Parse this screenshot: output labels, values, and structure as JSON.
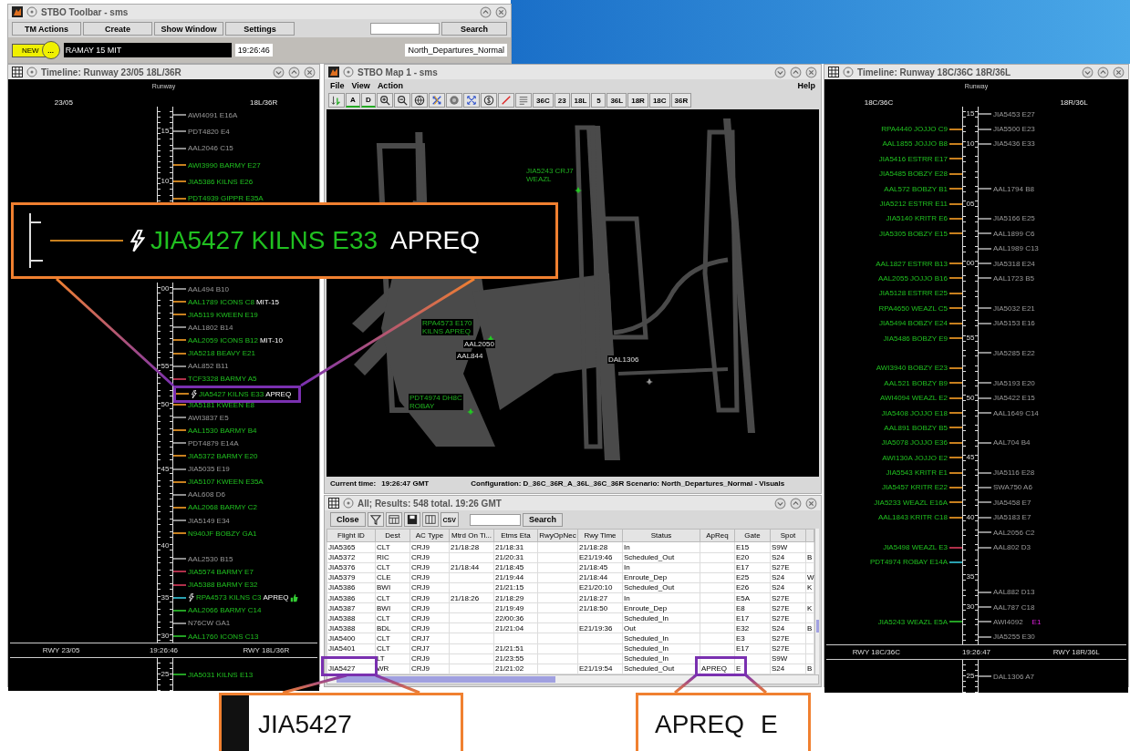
{
  "toolbar_window": {
    "title": "STBO Toolbar - sms",
    "buttons": [
      "TM Actions",
      "Create",
      "Show Window",
      "Settings"
    ],
    "search_button": "Search",
    "new_badge": "NEW",
    "more_button": "...",
    "message": "RAMAY 15 MIT",
    "time": "19:26:46",
    "scenario": "North_Departures_Normal"
  },
  "timelines": [
    {
      "title": "Timeline: Runway 23/05 18L/36R",
      "header": "Runway",
      "left_runway": "23/05",
      "right_runway": "18L/36R",
      "row_groups": [
        {
          "rows": [
            {
              "right": {
                "text": "AWI4091 E16A",
                "assigned": false,
                "color": "#8c8c8c",
                "flagged": false,
                "approved": false
              }
            },
            {
              "tick": "15",
              "right": {
                "text": "PDT4820 E4",
                "assigned": false,
                "color": "#8c8c8c",
                "flagged": false,
                "approved": false
              }
            },
            {
              "right": {
                "text": "AAL2046 C15",
                "assigned": false,
                "color": "#8c8c8c",
                "flagged": false,
                "approved": false
              }
            },
            {
              "right": {
                "text": "AWI3990 BARMY E27",
                "assigned": true,
                "color": "#c8801e",
                "flagged": false,
                "approved": false
              }
            },
            {
              "tick": "10",
              "right": {
                "text": "JIA5386 KILNS E26",
                "assigned": true,
                "color": "#c8801e",
                "flagged": false,
                "approved": false
              }
            },
            {
              "right": {
                "text": "PDT4939 GIPPR E35A",
                "assigned": true,
                "color": "#c8801e",
                "flagged": false,
                "approved": false
              }
            }
          ]
        },
        {
          "rows": [
            {
              "tick": "00",
              "right": {
                "text": "AAL494 B10",
                "assigned": false,
                "color": "#8c8c8c",
                "flagged": false,
                "approved": false
              }
            },
            {
              "right": {
                "text": "AAL1789 ICONS C8",
                "assigned": true,
                "color": "#c8801e",
                "flagged": false,
                "approved": false,
                "note": "MIT-15"
              }
            },
            {
              "right": {
                "text": "JIA5119 KWEEN E19",
                "assigned": true,
                "color": "#c8801e",
                "flagged": false,
                "approved": false
              }
            },
            {
              "right": {
                "text": "AAL1802 B14",
                "assigned": false,
                "color": "#8c8c8c",
                "flagged": false,
                "approved": false
              }
            },
            {
              "right": {
                "text": "AAL2059 ICONS B12",
                "assigned": true,
                "color": "#c8801e",
                "flagged": false,
                "approved": false,
                "note": "MIT-10"
              }
            },
            {
              "right": {
                "text": "JIA5218 BEAVY E21",
                "assigned": true,
                "color": "#c8801e",
                "flagged": false,
                "approved": false
              }
            },
            {
              "tick": "55",
              "right": {
                "text": "AAL852 B11",
                "assigned": false,
                "color": "#8c8c8c",
                "flagged": false,
                "approved": false
              }
            },
            {
              "right": {
                "text": "TCF3328 BARMY A5",
                "assigned": true,
                "color": "#b0304a",
                "flagged": false,
                "approved": false
              }
            },
            {
              "right": {
                "text": "JIA5427 KILNS E33",
                "assigned": true,
                "color": "#c8801e",
                "flagged": true,
                "approved": false,
                "note": "APREQ",
                "framed": true
              }
            },
            {
              "tick": "50",
              "right": {
                "text": "JIA5181 KWEEN E8",
                "assigned": true,
                "color": "#c8801e",
                "flagged": false,
                "approved": false
              }
            },
            {
              "right": {
                "text": "AWI3837 E5",
                "assigned": false,
                "color": "#8c8c8c",
                "flagged": false,
                "approved": false
              }
            },
            {
              "right": {
                "text": "AAL1530 BARMY B4",
                "assigned": true,
                "color": "#c8801e",
                "flagged": false,
                "approved": false
              }
            },
            {
              "right": {
                "text": "PDT4879 E14A",
                "assigned": false,
                "color": "#8c8c8c",
                "flagged": false,
                "approved": false
              }
            },
            {
              "right": {
                "text": "JIA5372 BARMY E20",
                "assigned": true,
                "color": "#c8801e",
                "flagged": false,
                "approved": false
              }
            },
            {
              "tick": "45",
              "right": {
                "text": "JIA5035 E19",
                "assigned": false,
                "color": "#8c8c8c",
                "flagged": false,
                "approved": false
              }
            },
            {
              "right": {
                "text": "JIA5107 KWEEN E35A",
                "assigned": true,
                "color": "#c8801e",
                "flagged": false,
                "approved": false
              }
            },
            {
              "right": {
                "text": "AAL608 D6",
                "assigned": false,
                "color": "#8c8c8c",
                "flagged": false,
                "approved": false
              }
            },
            {
              "right": {
                "text": "AAL2068 BARMY C2",
                "assigned": true,
                "color": "#c8801e",
                "flagged": false,
                "approved": false
              }
            },
            {
              "right": {
                "text": "JIA5149 E34",
                "assigned": false,
                "color": "#8c8c8c",
                "flagged": false,
                "approved": false
              }
            },
            {
              "right": {
                "text": "N940JF BOBZY GA1",
                "assigned": true,
                "color": "#c8801e",
                "flagged": false,
                "approved": false
              }
            },
            {
              "tick": "40"
            },
            {
              "right": {
                "text": "AAL2530 B15",
                "assigned": false,
                "color": "#8c8c8c",
                "flagged": false,
                "approved": false
              }
            },
            {
              "right": {
                "text": "JIA5574 BARMY E7",
                "assigned": true,
                "color": "#b0304a",
                "flagged": false,
                "approved": false
              }
            },
            {
              "right": {
                "text": "JIA5388 BARMY E32",
                "assigned": true,
                "color": "#b0304a",
                "flagged": false,
                "approved": false
              }
            },
            {
              "tick": "35",
              "right": {
                "text": "RPA4573 KILNS C3",
                "assigned": true,
                "color": "#2aa0b0",
                "flagged": true,
                "approved": true,
                "note": "APREQ"
              }
            },
            {
              "right": {
                "text": "AAL2066 BARMY C14",
                "assigned": true,
                "color": "#23a023",
                "flagged": false,
                "approved": false
              }
            },
            {
              "right": {
                "text": "N76CW GA1",
                "assigned": false,
                "color": "#8c8c8c",
                "flagged": false,
                "approved": false
              }
            },
            {
              "tick": "30",
              "right": {
                "text": "AAL1760 ICONS C13",
                "assigned": true,
                "color": "#23a023",
                "flagged": false,
                "approved": false
              }
            }
          ]
        }
      ],
      "footer": {
        "left": "RWY 23/05",
        "time": "19:26:46",
        "right": "RWY 18L/36R"
      },
      "below_rows": [
        {
          "tick": "25",
          "right": {
            "text": "JIA5031 KILNS E13",
            "assigned": true,
            "color": "#23a023",
            "flagged": false,
            "approved": false
          }
        }
      ]
    },
    {
      "title": "Timeline: Runway 18C/36C 18R/36L",
      "header": "Runway",
      "left_runway": "18C/36C",
      "right_runway": "18R/36L",
      "row_groups": [
        {
          "rows": [
            {
              "tick": "15",
              "right": {
                "text": "JIA5453 E27",
                "assigned": false,
                "color": "#8c8c8c",
                "flagged": false,
                "approved": false
              }
            },
            {
              "left": {
                "text": "RPA4440 JOJJO C9",
                "assigned": true,
                "color": "#c8801e",
                "flagged": false,
                "approved": false
              },
              "right": {
                "text": "JIA5500 E23",
                "assigned": false,
                "color": "#8c8c8c",
                "flagged": false,
                "approved": false
              }
            },
            {
              "tick": "10",
              "left": {
                "text": "AAL1855 JOJJO B8",
                "assigned": true,
                "color": "#c8801e",
                "flagged": false,
                "approved": false
              },
              "right": {
                "text": "JIA5436 E33",
                "assigned": false,
                "color": "#8c8c8c",
                "flagged": false,
                "approved": false
              }
            },
            {
              "left": {
                "text": "JIA5416 ESTRR E17",
                "assigned": true,
                "color": "#c8801e",
                "flagged": false,
                "approved": false
              }
            },
            {
              "left": {
                "text": "JIA5485 BOBZY E28",
                "assigned": true,
                "color": "#c8801e",
                "flagged": false,
                "approved": false
              }
            },
            {
              "left": {
                "text": "AAL572 BOBZY B1",
                "assigned": true,
                "color": "#c8801e",
                "flagged": false,
                "approved": false
              },
              "right": {
                "text": "AAL1794 B8",
                "assigned": false,
                "color": "#8c8c8c",
                "flagged": false,
                "approved": false
              }
            },
            {
              "tick": "05",
              "left": {
                "text": "JIA5212 ESTRR E11",
                "assigned": true,
                "color": "#c8801e",
                "flagged": false,
                "approved": false
              }
            },
            {
              "left": {
                "text": "JIA5140 KRITR E6",
                "assigned": true,
                "color": "#c8801e",
                "flagged": false,
                "approved": false
              },
              "right": {
                "text": "JIA5166 E25",
                "assigned": false,
                "color": "#8c8c8c",
                "flagged": false,
                "approved": false
              }
            },
            {
              "left": {
                "text": "JIA5305 BOBZY E15",
                "assigned": true,
                "color": "#c8801e",
                "flagged": false,
                "approved": false
              },
              "right": {
                "text": "AAL1899 C6",
                "assigned": false,
                "color": "#8c8c8c",
                "flagged": false,
                "approved": false
              }
            },
            {
              "right": {
                "text": "AAL1989 C13",
                "assigned": false,
                "color": "#8c8c8c",
                "flagged": false,
                "approved": false
              }
            },
            {
              "tick": "00",
              "left": {
                "text": "AAL1827 ESTRR B13",
                "assigned": true,
                "color": "#c8801e",
                "flagged": false,
                "approved": false
              },
              "right": {
                "text": "JIA5318 E24",
                "assigned": false,
                "color": "#8c8c8c",
                "flagged": false,
                "approved": false
              }
            },
            {
              "left": {
                "text": "AAL2055 JOJJO B16",
                "assigned": true,
                "color": "#c8801e",
                "flagged": false,
                "approved": false
              },
              "right": {
                "text": "AAL1723 B5",
                "assigned": false,
                "color": "#8c8c8c",
                "flagged": false,
                "approved": false
              }
            },
            {
              "left": {
                "text": "JIA5128 ESTRR E25",
                "assigned": true,
                "color": "#c8801e",
                "flagged": false,
                "approved": false
              }
            },
            {
              "left": {
                "text": "RPA4650 WEAZL C5",
                "assigned": true,
                "color": "#c8801e",
                "flagged": false,
                "approved": false
              },
              "right": {
                "text": "JIA5032 E21",
                "assigned": false,
                "color": "#8c8c8c",
                "flagged": false,
                "approved": false
              }
            },
            {
              "left": {
                "text": "JIA5494 BOBZY E24",
                "assigned": true,
                "color": "#c8801e",
                "flagged": false,
                "approved": false
              },
              "right": {
                "text": "JIA5153 E16",
                "assigned": false,
                "color": "#8c8c8c",
                "flagged": false,
                "approved": false
              }
            },
            {
              "tick": "55",
              "left": {
                "text": "JIA5486 BOBZY E9",
                "assigned": true,
                "color": "#c8801e",
                "flagged": false,
                "approved": false
              }
            },
            {
              "right": {
                "text": "JIA5285 E22",
                "assigned": false,
                "color": "#8c8c8c",
                "flagged": false,
                "approved": false
              }
            },
            {
              "left": {
                "text": "AWI3940 BOBZY E23",
                "assigned": true,
                "color": "#c8801e",
                "flagged": false,
                "approved": false
              }
            },
            {
              "left": {
                "text": "AAL521 BOBZY B9",
                "assigned": true,
                "color": "#c8801e",
                "flagged": false,
                "approved": false
              },
              "right": {
                "text": "JIA5193 E20",
                "assigned": false,
                "color": "#8c8c8c",
                "flagged": false,
                "approved": false
              }
            },
            {
              "tick": "50",
              "left": {
                "text": "AWI4094 WEAZL E2",
                "assigned": true,
                "color": "#c8801e",
                "flagged": false,
                "approved": false
              },
              "right": {
                "text": "JIA5422 E15",
                "assigned": false,
                "color": "#8c8c8c",
                "flagged": false,
                "approved": false
              }
            },
            {
              "left": {
                "text": "JIA5408 JOJJO E18",
                "assigned": true,
                "color": "#c8801e",
                "flagged": false,
                "approved": false
              },
              "right": {
                "text": "AAL1649 C14",
                "assigned": false,
                "color": "#8c8c8c",
                "flagged": false,
                "approved": false
              }
            },
            {
              "left": {
                "text": "AAL891 BOBZY B5",
                "assigned": true,
                "color": "#c8801e",
                "flagged": false,
                "approved": false
              }
            },
            {
              "left": {
                "text": "JIA5078 JOJJO E36",
                "assigned": true,
                "color": "#c8801e",
                "flagged": false,
                "approved": false
              },
              "right": {
                "text": "AAL704 B4",
                "assigned": false,
                "color": "#8c8c8c",
                "flagged": false,
                "approved": false
              }
            },
            {
              "tick": "45",
              "left": {
                "text": "AWI130A JOJJO E2",
                "assigned": true,
                "color": "#c8801e",
                "flagged": false,
                "approved": false
              }
            },
            {
              "left": {
                "text": "JIA5543 KRITR E1",
                "assigned": true,
                "color": "#c8801e",
                "flagged": false,
                "approved": false
              },
              "right": {
                "text": "JIA5116 E28",
                "assigned": false,
                "color": "#8c8c8c",
                "flagged": false,
                "approved": false
              }
            },
            {
              "left": {
                "text": "JIA5457 KRITR E22",
                "assigned": true,
                "color": "#c8801e",
                "flagged": false,
                "approved": false
              },
              "right": {
                "text": "SWA750 A6",
                "assigned": false,
                "color": "#8c8c8c",
                "flagged": false,
                "approved": false
              }
            },
            {
              "left": {
                "text": "JIA5233 WEAZL E16A",
                "assigned": true,
                "color": "#c8801e",
                "flagged": false,
                "approved": false
              },
              "right": {
                "text": "JIA5458 E7",
                "assigned": false,
                "color": "#8c8c8c",
                "flagged": false,
                "approved": false
              }
            },
            {
              "tick": "40",
              "left": {
                "text": "AAL1843 KRITR C18",
                "assigned": true,
                "color": "#c8801e",
                "flagged": false,
                "approved": false
              },
              "right": {
                "text": "JIA5183 E7",
                "assigned": false,
                "color": "#8c8c8c",
                "flagged": false,
                "approved": false
              }
            },
            {
              "right": {
                "text": "AAL2056 C2",
                "assigned": false,
                "color": "#8c8c8c",
                "flagged": false,
                "approved": false
              }
            },
            {
              "left": {
                "text": "JIA5498 WEAZL E3",
                "assigned": true,
                "color": "#b0304a",
                "flagged": false,
                "approved": false
              },
              "right": {
                "text": "AAL802 D3",
                "assigned": false,
                "color": "#8c8c8c",
                "flagged": false,
                "approved": false
              }
            },
            {
              "left": {
                "text": "PDT4974 ROBAY E14A",
                "assigned": true,
                "color": "#2aa0b0",
                "flagged": false,
                "approved": false
              }
            },
            {
              "tick": "35"
            },
            {
              "right": {
                "text": "AAL882 D13",
                "assigned": false,
                "color": "#8c8c8c",
                "flagged": false,
                "approved": false
              }
            },
            {
              "tick": "30",
              "right": {
                "text": "AAL787 C18",
                "assigned": false,
                "color": "#8c8c8c",
                "flagged": false,
                "approved": false
              }
            },
            {
              "left": {
                "text": "JIA5243 WEAZL E5A",
                "assigned": true,
                "color": "#23a023",
                "flagged": false,
                "approved": false
              },
              "right": {
                "text": "AWI4092",
                "assigned": false,
                "color": "#8c8c8c",
                "flagged": false,
                "approved": false,
                "alert": "E1"
              }
            },
            {
              "right": {
                "text": "JIA5255 E30",
                "assigned": false,
                "color": "#8c8c8c",
                "flagged": false,
                "approved": false
              }
            }
          ]
        }
      ],
      "footer": {
        "left": "RWY 18C/36C",
        "time": "19:26:47",
        "right": "RWY 18R/36L"
      },
      "below_rows": [
        {
          "tick": "25",
          "right": {
            "text": "DAL1306 A7",
            "assigned": false,
            "color": "#8c8c8c",
            "flagged": false,
            "approved": false
          }
        }
      ]
    }
  ],
  "map_window": {
    "title": "STBO Map 1 - sms",
    "menu": [
      "File",
      "View",
      "Action"
    ],
    "help_menu": "Help",
    "letter_tools": [
      "A",
      "D"
    ],
    "runway_buttons": [
      "36C",
      "23",
      "18L",
      "5",
      "36L",
      "18R",
      "18C",
      "36R"
    ],
    "labels": [
      {
        "lines": [
          "JIA5243 CRJ7",
          "WEAZL"
        ],
        "assigned": true
      },
      {
        "lines": [
          "RPA4573 E170",
          "KILNS APREQ"
        ],
        "assigned": true
      },
      {
        "lines": [
          "AAL2050"
        ],
        "assigned": false
      },
      {
        "lines": [
          "AAL844"
        ],
        "assigned": false
      },
      {
        "lines": [
          "DAL1306"
        ],
        "assigned": false
      },
      {
        "lines": [
          "PDT4974 DH8C",
          "ROBAY"
        ],
        "assigned": true
      }
    ],
    "current_time_label": "Current time:",
    "current_time": "19:26:47 GMT",
    "configuration": "Configuration: D_36C_36R_A_36L_36C_36R Scenario: North_Departures_Normal - Visuals"
  },
  "results_window": {
    "title": "All; Results: 548 total. 19:26 GMT",
    "close_button": "Close",
    "csv_button": "CSV",
    "search_button": "Search",
    "columns": [
      "Flight ID",
      "Dest",
      "AC Type",
      "Mtrd On Ti...",
      "Etms Eta",
      "RwyOpNec",
      "Rwy Time",
      "Status",
      "ApReq",
      "Gate",
      "Spot"
    ],
    "rows": [
      [
        "JIA5365",
        "CLT",
        "CRJ9",
        "21/18:28",
        "21/18:31",
        null,
        "21/18:28",
        "In",
        null,
        "E15",
        "S9W",
        null
      ],
      [
        "JIA5372",
        "RIC",
        "CRJ9",
        null,
        "21/20:31",
        null,
        "E21/19:46",
        "Scheduled_Out",
        null,
        "E20",
        "S24",
        "B"
      ],
      [
        "JIA5376",
        "CLT",
        "CRJ9",
        "21/18:44",
        "21/18:45",
        null,
        "21/18:45",
        "In",
        null,
        "E17",
        "S27E",
        null
      ],
      [
        "JIA5379",
        "CLE",
        "CRJ9",
        null,
        "21/19:44",
        null,
        "21/18:44",
        "Enroute_Dep",
        null,
        "E25",
        "S24",
        "W"
      ],
      [
        "JIA5386",
        "BWI",
        "CRJ9",
        null,
        "21/21:15",
        null,
        "E21/20:10",
        "Scheduled_Out",
        null,
        "E26",
        "S24",
        "K"
      ],
      [
        "JIA5386",
        "CLT",
        "CRJ9",
        "21/18:26",
        "21/18:29",
        null,
        "21/18:27",
        "In",
        null,
        "E5A",
        "S27E",
        null
      ],
      [
        "JIA5387",
        "BWI",
        "CRJ9",
        null,
        "21/19:49",
        null,
        "21/18:50",
        "Enroute_Dep",
        null,
        "E8",
        "S27E",
        "K"
      ],
      [
        "JIA5388",
        "CLT",
        "CRJ9",
        null,
        "22/00:36",
        null,
        null,
        "Scheduled_In",
        null,
        "E17",
        "S27E",
        null
      ],
      [
        "JIA5388",
        "BDL",
        "CRJ9",
        null,
        "21/21:04",
        null,
        "E21/19:36",
        "Out",
        null,
        "E32",
        "S24",
        "B"
      ],
      [
        "JIA5400",
        "CLT",
        "CRJ7",
        null,
        null,
        null,
        null,
        "Scheduled_In",
        null,
        "E3",
        "S27E",
        null
      ],
      [
        "JIA5401",
        "CLT",
        "CRJ7",
        null,
        "21/21:51",
        null,
        null,
        "Scheduled_In",
        null,
        "E17",
        "S27E",
        null
      ],
      [
        null,
        "LT",
        "CRJ9",
        null,
        "21/23:55",
        null,
        null,
        "Scheduled_In",
        null,
        null,
        "S9W",
        null
      ],
      [
        "JIA5427",
        "WR",
        "CRJ9",
        null,
        "21/21:02",
        null,
        "E21/19:54",
        "Scheduled_Out",
        "APREQ",
        "E",
        "S24",
        "B"
      ]
    ]
  },
  "callouts": {
    "main": {
      "text": "JIA5427 KILNS E33",
      "note": "APREQ"
    },
    "flight_id": "JIA5427",
    "apreq": "APREQ",
    "apreq_next": "E"
  }
}
